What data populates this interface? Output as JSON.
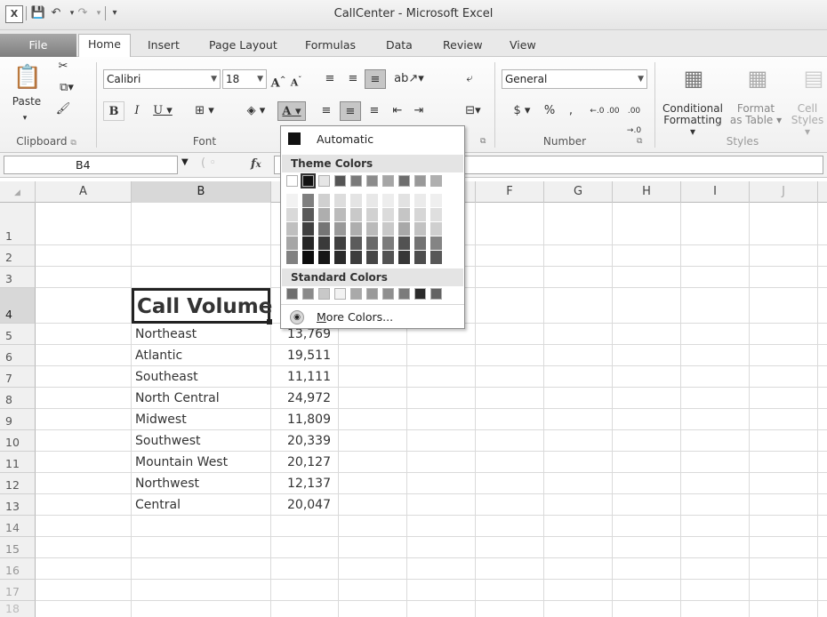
{
  "window": {
    "title": "CallCenter - Microsoft Excel"
  },
  "quick_access": {
    "undo_icon": "undo-icon",
    "redo_icon": "redo-icon",
    "save_icon": "save-icon"
  },
  "tabs": [
    {
      "label": "File"
    },
    {
      "label": "Home"
    },
    {
      "label": "Insert"
    },
    {
      "label": "Page Layout"
    },
    {
      "label": "Formulas"
    },
    {
      "label": "Data"
    },
    {
      "label": "Review"
    },
    {
      "label": "View"
    }
  ],
  "ribbon": {
    "clipboard": {
      "paste_label": "Paste",
      "group_label": "Clipboard"
    },
    "font": {
      "font_name": "Calibri",
      "font_size": "18",
      "group_label": "Font"
    },
    "number": {
      "format": "General",
      "group_label": "Number",
      "currency": "$",
      "percent": "%",
      "comma": ",",
      "inc_decimal": "←.0 .00",
      "dec_decimal": ".00 →.0"
    },
    "styles": {
      "conditional_line1": "Conditional",
      "conditional_line2": "Formatting ▾",
      "format_table_line1": "Format",
      "format_table_line2": "as Table ▾",
      "cell_styles_line1": "Cell",
      "cell_styles_line2": "Styles ▾",
      "group_label": "Styles"
    }
  },
  "formula_bar": {
    "name_box": "B4",
    "fx": "fx",
    "value": ""
  },
  "columns": [
    "A",
    "B",
    "C",
    "D",
    "E",
    "F",
    "G",
    "H",
    "I",
    "J"
  ],
  "rows": [
    "1",
    "2",
    "3",
    "4",
    "5",
    "6",
    "7",
    "8",
    "9",
    "10",
    "11",
    "12",
    "13",
    "14",
    "15",
    "16",
    "17",
    "18"
  ],
  "sheet": {
    "header": "Call Volume",
    "regions": [
      {
        "name": "Northeast",
        "value": "13,769"
      },
      {
        "name": "Atlantic",
        "value": "19,511"
      },
      {
        "name": "Southeast",
        "value": "11,111"
      },
      {
        "name": "North Central",
        "value": "24,972"
      },
      {
        "name": "Midwest",
        "value": "11,809"
      },
      {
        "name": "Southwest",
        "value": "20,339"
      },
      {
        "name": "Mountain West",
        "value": "20,127"
      },
      {
        "name": "Northwest",
        "value": "12,137"
      },
      {
        "name": "Central",
        "value": "20,047"
      }
    ]
  },
  "font_color_menu": {
    "automatic": "Automatic",
    "theme_colors_label": "Theme Colors",
    "standard_colors_label": "Standard Colors",
    "more_colors": "More Colors...",
    "theme_top": [
      "#ffffff",
      "#111111",
      "#e6e6e6",
      "#555555",
      "#7a7a7a",
      "#8c8c8c",
      "#a6a6a6",
      "#6e6e6e",
      "#999999",
      "#b0b0b0"
    ],
    "theme_shades": [
      [
        "#f2f2f2",
        "#d9d9d9",
        "#bfbfbf",
        "#a6a6a6",
        "#808080"
      ],
      [
        "#7f7f7f",
        "#595959",
        "#404040",
        "#262626",
        "#0d0d0d"
      ],
      [
        "#d0d0d0",
        "#aeaeae",
        "#757575",
        "#3a3a3a",
        "#161616"
      ],
      [
        "#dddddd",
        "#bbbbbb",
        "#999999",
        "#404040",
        "#2a2a2a"
      ],
      [
        "#e4e4e4",
        "#c9c9c9",
        "#aeaeae",
        "#5b5b5b",
        "#3d3d3d"
      ],
      [
        "#e8e8e8",
        "#d1d1d1",
        "#bababa",
        "#696969",
        "#464646"
      ],
      [
        "#ededed",
        "#dbdbdb",
        "#c9c9c9",
        "#7c7c7c",
        "#535353"
      ],
      [
        "#e2e2e2",
        "#c5c5c5",
        "#a8a8a8",
        "#525252",
        "#373737"
      ],
      [
        "#ebebeb",
        "#d6d6d6",
        "#c2c2c2",
        "#737373",
        "#4d4d4d"
      ],
      [
        "#efefef",
        "#dfdfdf",
        "#cfcfcf",
        "#848484",
        "#585858"
      ]
    ],
    "standard": [
      "#6f6f6f",
      "#8a8a8a",
      "#c8c8c8",
      "#f2f2f2",
      "#a9a9a9",
      "#9a9a9a",
      "#8f8f8f",
      "#7b7b7b",
      "#2b2b2b",
      "#636363"
    ]
  }
}
